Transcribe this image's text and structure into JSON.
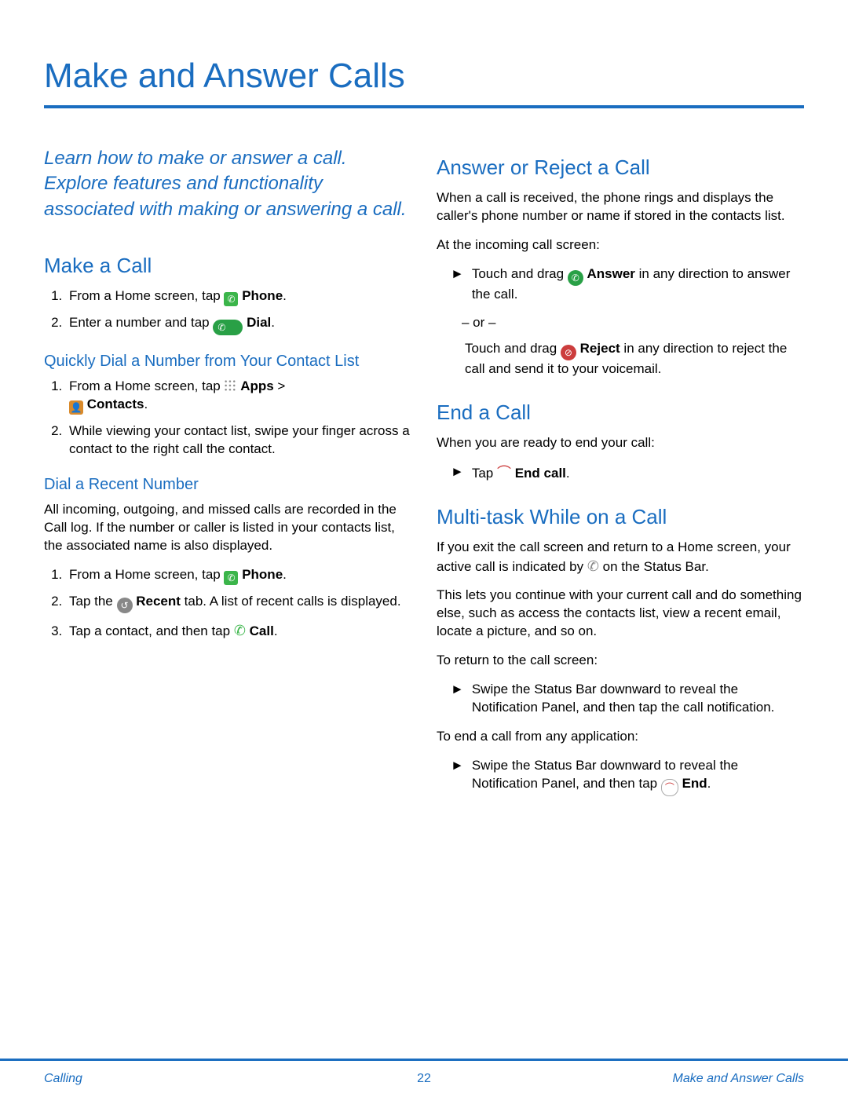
{
  "title": "Make and Answer Calls",
  "intro": "Learn how to make or answer a call. Explore features and functionality associated with making or answering a call.",
  "left": {
    "make_call_heading": "Make a Call",
    "mc_step1_a": "From a Home screen, tap ",
    "mc_step1_b": " Phone",
    "mc_step1_c": ".",
    "mc_step2_a": "Enter a number and tap ",
    "mc_step2_b": " Dial",
    "mc_step2_c": ".",
    "quick_dial_heading": "Quickly Dial a Number from Your Contact List",
    "qd_step1_a": "From a Home screen, tap ",
    "qd_step1_b": " Apps",
    "qd_step1_c": " > ",
    "qd_step1_d": " Contacts",
    "qd_step1_e": ".",
    "qd_step2": "While viewing your contact list, swipe your finger across a contact to the right call the contact.",
    "dial_recent_heading": "Dial a Recent Number",
    "dr_body": "All incoming, outgoing, and missed calls are recorded in the Call log. If the number or caller is listed in your contacts list, the associated name is also displayed.",
    "dr_step1_a": "From a Home screen, tap ",
    "dr_step1_b": " Phone",
    "dr_step1_c": ".",
    "dr_step2_a": "Tap the ",
    "dr_step2_b": " Recent",
    "dr_step2_c": " tab. A list of recent calls is displayed.",
    "dr_step3_a": "Tap a contact, and then tap ",
    "dr_step3_b": " Call",
    "dr_step3_c": "."
  },
  "right": {
    "answer_heading": "Answer or Reject a Call",
    "ar_body1": "When a call is received, the phone rings and displays the caller's phone number or name if stored in the contacts list.",
    "ar_body2": "At the incoming call screen:",
    "ar_bullet1_a": "Touch and drag ",
    "ar_bullet1_b": " Answer",
    "ar_bullet1_c": " in any direction to answer the call.",
    "or_label": "– or –",
    "ar_bullet2_a": "Touch and drag ",
    "ar_bullet2_b": " Reject",
    "ar_bullet2_c": " in any direction to reject the call and send it to your voicemail.",
    "end_heading": "End a Call",
    "end_body": "When you are ready to end your call:",
    "end_bullet_a": "Tap ",
    "end_bullet_b": " End call",
    "end_bullet_c": ".",
    "multi_heading": "Multi-task While on a Call",
    "mt_body1_a": "If you exit the call screen and return to a Home screen, your active call is indicated by ",
    "mt_body1_b": " on the Status Bar.",
    "mt_body2": "This lets you continue with your current call and do something else, such as access the contacts list, view a recent email, locate a picture, and so on.",
    "mt_body3": "To return to the call screen:",
    "mt_bullet1": "Swipe the Status Bar downward to reveal the Notification Panel, and then tap the call notification.",
    "mt_body4": "To end a call from any application:",
    "mt_bullet2_a": "Swipe the Status Bar downward to reveal the Notification Panel, and then tap ",
    "mt_bullet2_b": " End",
    "mt_bullet2_c": "."
  },
  "footer": {
    "left": "Calling",
    "center": "22",
    "right": "Make and Answer Calls"
  },
  "glyphs": {
    "arrow": "►",
    "phone": "✆",
    "handset": "✆",
    "person": "👤",
    "recent": "↺",
    "reject": "⊘",
    "end": "⏻",
    "status": "✆"
  }
}
